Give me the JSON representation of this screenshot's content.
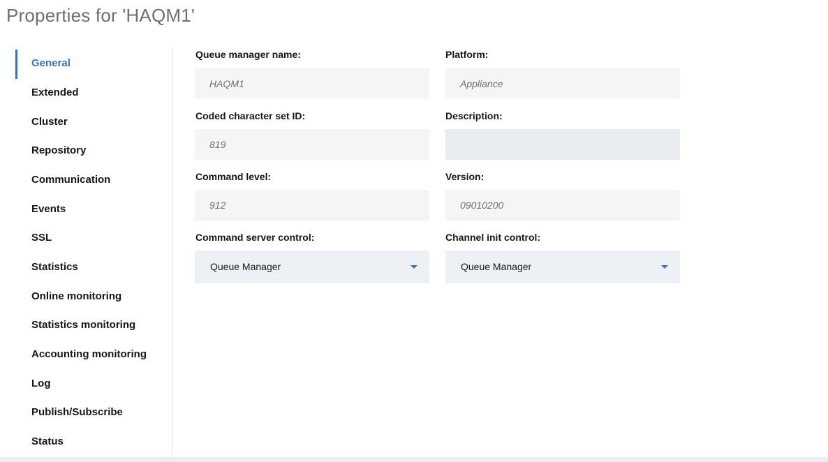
{
  "page": {
    "title": "Properties for 'HAQM1'"
  },
  "sidebar": {
    "items": [
      {
        "label": "General",
        "active": true
      },
      {
        "label": "Extended"
      },
      {
        "label": "Cluster"
      },
      {
        "label": "Repository"
      },
      {
        "label": "Communication"
      },
      {
        "label": "Events"
      },
      {
        "label": "SSL"
      },
      {
        "label": "Statistics"
      },
      {
        "label": "Online monitoring"
      },
      {
        "label": "Statistics monitoring"
      },
      {
        "label": "Accounting monitoring"
      },
      {
        "label": "Log"
      },
      {
        "label": "Publish/Subscribe"
      },
      {
        "label": "Status"
      }
    ]
  },
  "form": {
    "queue_manager_name": {
      "label": "Queue manager name:",
      "value": "HAQM1"
    },
    "platform": {
      "label": "Platform:",
      "value": "Appliance"
    },
    "ccsid": {
      "label": "Coded character set ID:",
      "value": "819"
    },
    "description": {
      "label": "Description:",
      "value": ""
    },
    "command_level": {
      "label": "Command level:",
      "value": "912"
    },
    "version": {
      "label": "Version:",
      "value": "09010200"
    },
    "command_server_control": {
      "label": "Command server control:",
      "value": "Queue Manager"
    },
    "channel_init_control": {
      "label": "Channel init control:",
      "value": "Queue Manager"
    }
  },
  "colors": {
    "accent": "#3d70b2",
    "field_background": "#f3f5f7",
    "select_background": "#edf1f6"
  },
  "icons": {
    "dropdown": "caret-down-icon"
  }
}
